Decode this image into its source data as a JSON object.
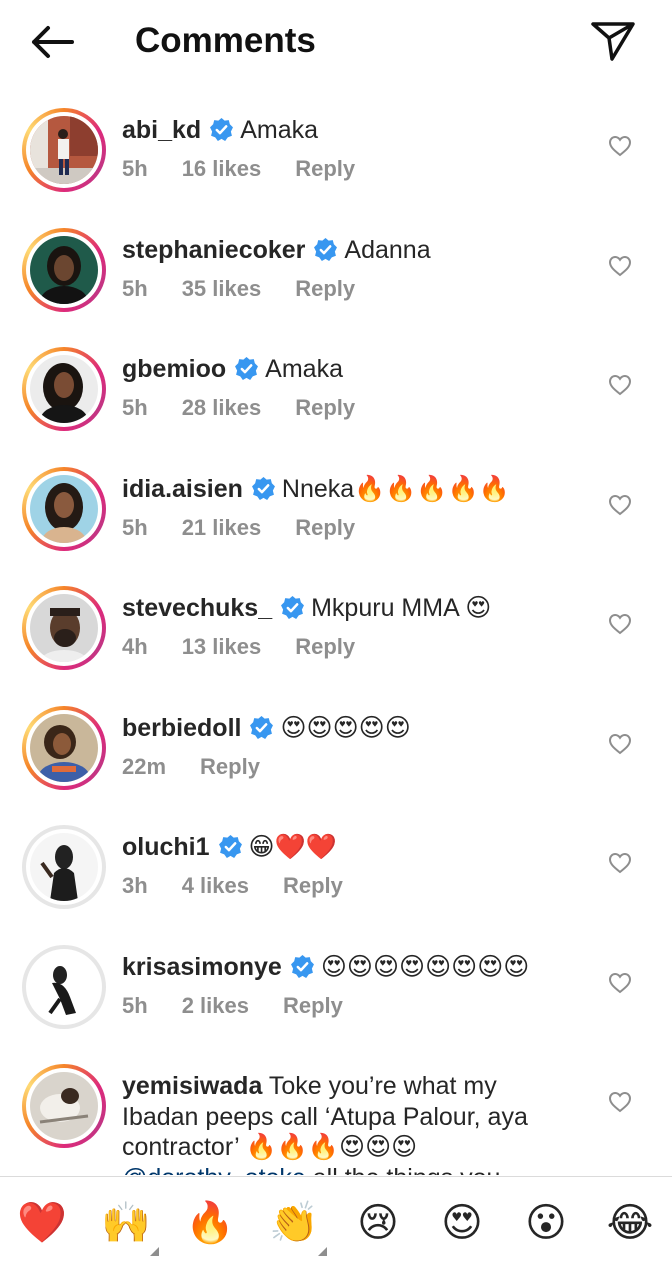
{
  "header": {
    "title": "Comments"
  },
  "comments": [
    {
      "username": "abi_kd",
      "text": "Amaka",
      "time": "5h",
      "likes": "16 likes",
      "reply": "Reply"
    },
    {
      "username": "stephaniecoker",
      "text": "Adanna",
      "time": "5h",
      "likes": "35 likes",
      "reply": "Reply"
    },
    {
      "username": "gbemioo",
      "text": "Amaka",
      "time": "5h",
      "likes": "28 likes",
      "reply": "Reply"
    },
    {
      "username": "idia.aisien",
      "text": "Nneka🔥🔥🔥🔥🔥",
      "time": "5h",
      "likes": "21 likes",
      "reply": "Reply"
    },
    {
      "username": "stevechuks_",
      "text": "Mkpuru MMA 😍",
      "time": "4h",
      "likes": "13 likes",
      "reply": "Reply"
    },
    {
      "username": "berbiedoll",
      "text": "😍😍😍😍😍",
      "time": "22m",
      "likes": "",
      "reply": "Reply"
    },
    {
      "username": "oluchi1",
      "text": "😁❤️❤️",
      "time": "3h",
      "likes": "4 likes",
      "reply": "Reply"
    },
    {
      "username": "krisasimonye",
      "text": "😍😍😍😍😍😍😍😍",
      "time": "5h",
      "likes": "2 likes",
      "reply": "Reply"
    },
    {
      "username": "yemisiwada",
      "text_part1": " Toke you’re what my Ibadan peeps call ‘Atupa Palour, aya contractor’ 🔥🔥🔥😍😍😍 ",
      "mention": "@dorothy_otoke",
      "text_part2": " all the things you taught me 😁"
    }
  ],
  "reactions": [
    "❤️",
    "🙌",
    "🔥",
    "👏",
    "😢",
    "😍",
    "😮",
    "😂"
  ],
  "colors": {
    "verified": "#3897f0",
    "meta": "#8e8e8e",
    "mention": "#00376b"
  }
}
